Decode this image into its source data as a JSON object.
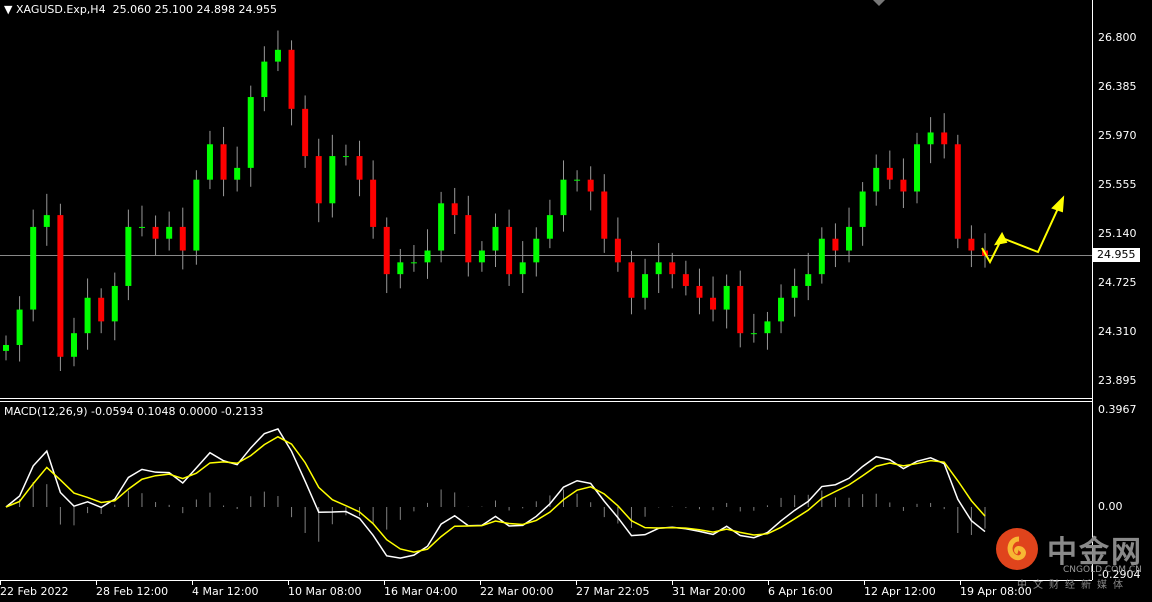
{
  "header": {
    "symbol": "XAGUSD.Exp,H4",
    "ohlc": "25.060 25.100 24.898 24.955"
  },
  "indicator": {
    "label": "MACD(12,26,9) -0.0594 0.1048 0.0000 -0.2133"
  },
  "current_price": "24.955",
  "colors": {
    "bull": "#00ff00",
    "bear": "#ff0000",
    "macd_main": "#ffffff",
    "macd_signal": "#ffff00",
    "histogram": "#808080",
    "arrow": "#ffff00"
  },
  "logo": {
    "cn": "中金网",
    "en": "CNGOLD.COM.CN",
    "sub": "中文财经新媒体"
  },
  "chart_data": {
    "type": "candlestick",
    "price_axis": {
      "ticks": [
        "26.800",
        "26.385",
        "25.970",
        "25.555",
        "25.140",
        "24.725",
        "24.310",
        "23.895"
      ],
      "range": [
        23.75,
        27.05
      ]
    },
    "macd_axis": {
      "ticks": [
        "0.3967",
        "0.00",
        "-0.2904"
      ],
      "range": [
        -0.2904,
        0.3967
      ]
    },
    "time_labels": [
      "22 Feb 2022",
      "28 Feb 12:00",
      "4 Mar 12:00",
      "10 Mar 08:00",
      "16 Mar 04:00",
      "22 Mar 00:00",
      "27 Mar 22:05",
      "31 Mar 20:00",
      "6 Apr 16:00",
      "12 Apr 12:00",
      "19 Apr 08:00"
    ],
    "closes": [
      24.2,
      24.5,
      25.2,
      25.3,
      24.1,
      24.3,
      24.6,
      24.4,
      24.7,
      25.2,
      25.2,
      25.1,
      25.2,
      25.0,
      25.6,
      25.9,
      25.6,
      25.7,
      26.3,
      26.6,
      26.7,
      26.2,
      25.8,
      25.4,
      25.8,
      25.8,
      25.6,
      25.2,
      24.8,
      24.9,
      24.9,
      25.0,
      25.4,
      25.3,
      24.9,
      25.0,
      25.2,
      24.8,
      24.9,
      25.1,
      25.3,
      25.6,
      25.6,
      25.5,
      25.1,
      24.9,
      24.6,
      24.8,
      24.9,
      24.8,
      24.7,
      24.6,
      24.5,
      24.7,
      24.3,
      24.3,
      24.4,
      24.6,
      24.7,
      24.8,
      25.1,
      25.0,
      25.2,
      25.5,
      25.7,
      25.6,
      25.5,
      25.9,
      26.0,
      25.9,
      25.1,
      25.0,
      24.955
    ],
    "indicator": "MACD(12,26,9)"
  }
}
